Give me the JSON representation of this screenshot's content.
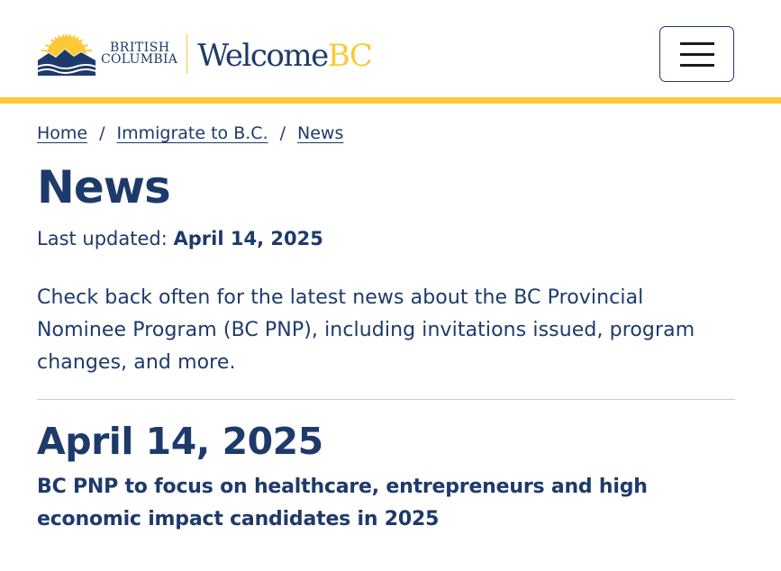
{
  "header": {
    "bc_logo_line1": "BRITISH",
    "bc_logo_line2": "COLUMBIA",
    "site_name_part1": "Welcome",
    "site_name_part2": "BC",
    "menu_icon": "hamburger-icon"
  },
  "breadcrumb": {
    "items": [
      "Home",
      "Immigrate to B.C.",
      "News"
    ],
    "separator": "/"
  },
  "page": {
    "title": "News",
    "updated_label": "Last updated:",
    "updated_date": "April 14, 2025",
    "intro": "Check back often for the latest news about the BC Provincial Nominee Program (BC PNP), including invitations issued, program changes, and more."
  },
  "news": {
    "date_heading": "April 14, 2025",
    "article_title": "BC PNP to focus on healthcare, entrepreneurs and high economic impact candidates in 2025"
  },
  "colors": {
    "brand_blue": "#1e3a6a",
    "brand_gold": "#fcc936"
  }
}
